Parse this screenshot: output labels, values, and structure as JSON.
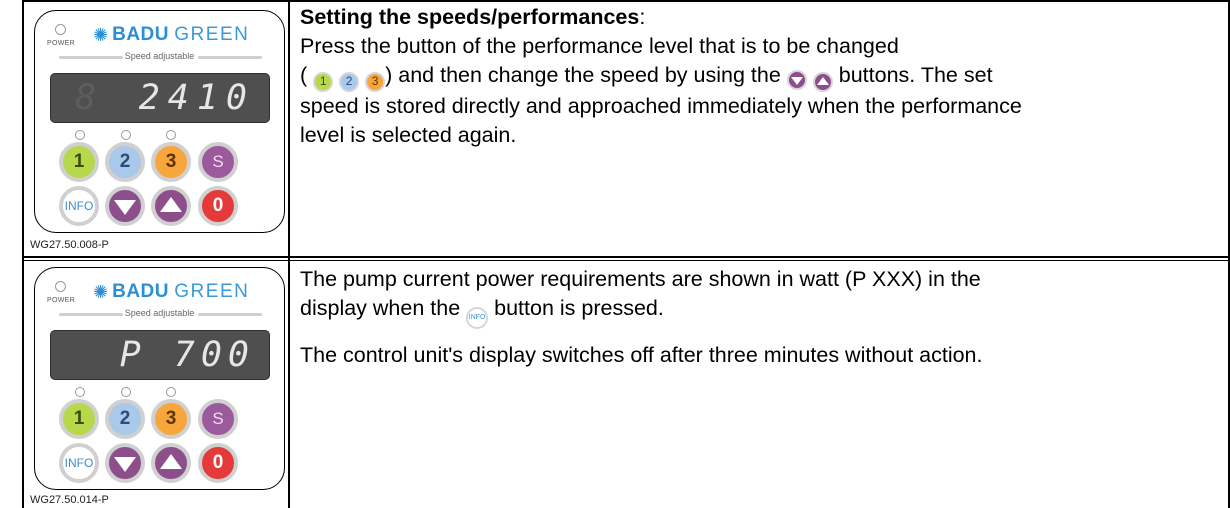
{
  "row1": {
    "figure_label": "WG27.50.008-P",
    "heading": "Setting the speeds/performances",
    "heading_suffix": ":",
    "line1": "Press the button of the performance level that is to be changed",
    "open_paren": "(",
    "close_part": ") and then change the speed by using the",
    "after_buttons": "buttons. The set",
    "line3": "speed is stored directly and approached immediately when the performance",
    "line4": "level is selected again.",
    "display_value": "2410",
    "inline_labels": [
      "1",
      "2",
      "3"
    ]
  },
  "row2": {
    "figure_label": "WG27.50.014-P",
    "p1_line1": "The pump current power requirements are shown in watt (P XXX) in the",
    "p1_before": "display when the",
    "p1_after": "button is pressed.",
    "p2": "The control unit's display switches off after three minutes without action.",
    "display_value": "P 700",
    "inline_info_label": "INFO"
  },
  "device": {
    "power_label": "POWER",
    "brand_main": "BADU",
    "brand_sub": "GREEN",
    "speed_label": "Speed adjustable",
    "btn_1": "1",
    "btn_2": "2",
    "btn_3": "3",
    "btn_s": "S",
    "btn_info": "INFO",
    "btn_0": "0"
  },
  "colors": {
    "brand_blue": "#2b8fd6",
    "level1_green": "#b7d84a",
    "level2_blue": "#a9c9ea",
    "level3_orange": "#f6a63b",
    "purple": "#8d4f8c",
    "stop_red": "#e53a3a",
    "display_gray": "#4f4f4f"
  },
  "icons": [
    "power-led-icon",
    "badu-swirl-logo-icon",
    "arrow-down-icon",
    "arrow-up-icon"
  ]
}
